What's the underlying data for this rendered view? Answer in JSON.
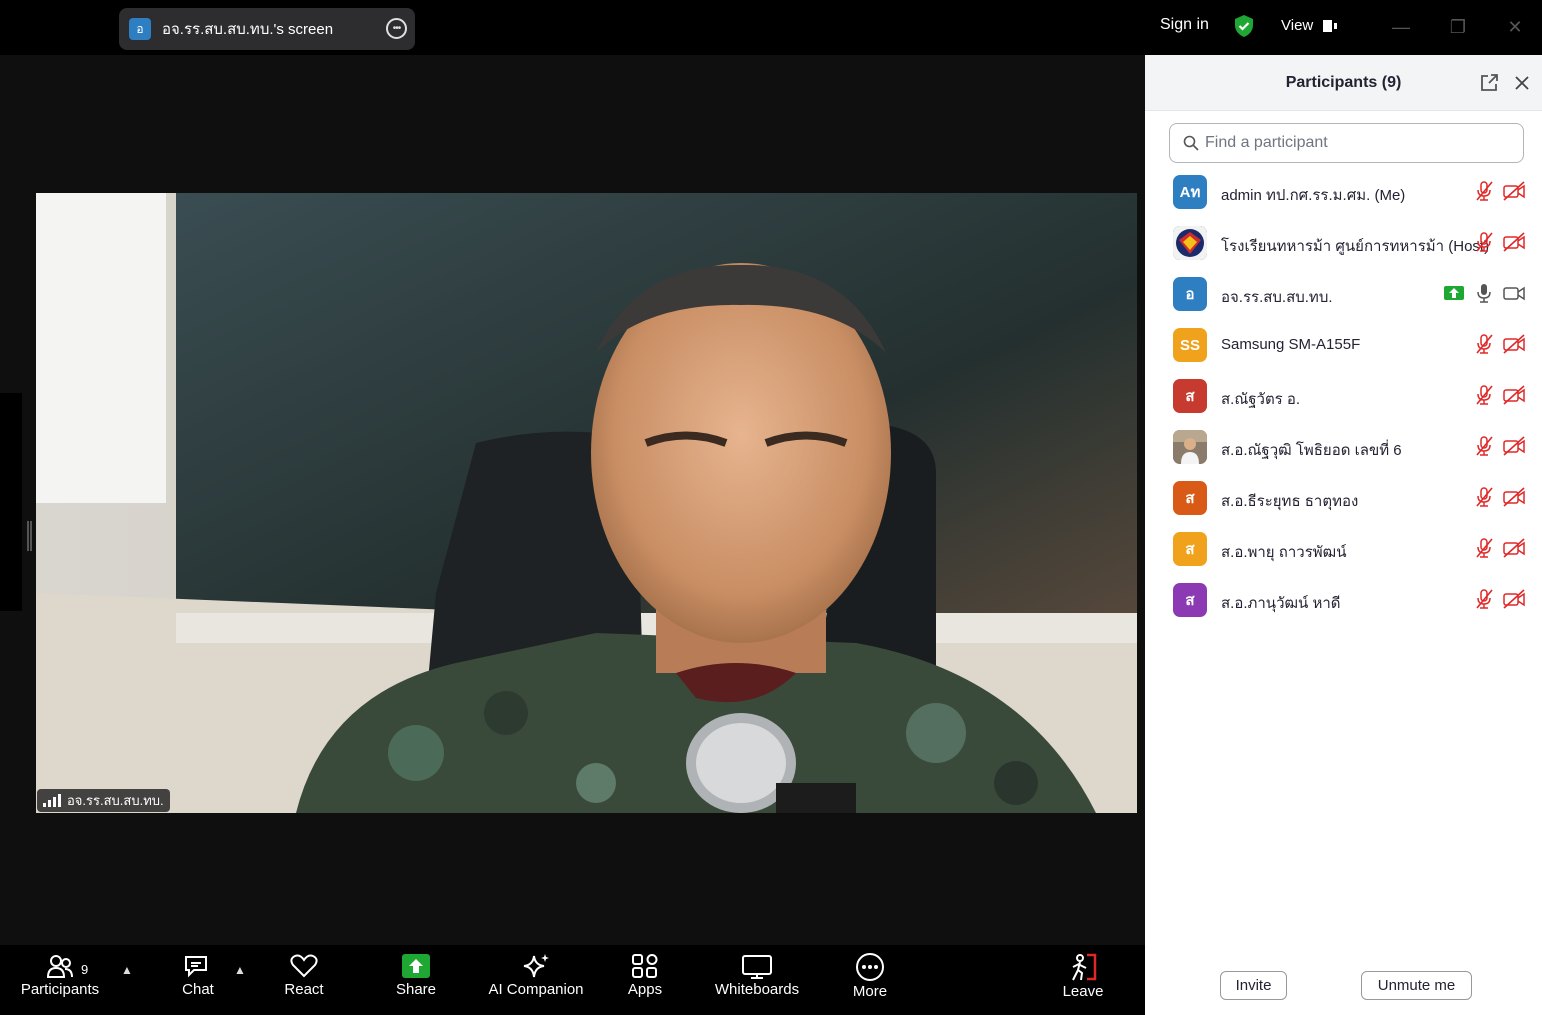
{
  "topbar": {
    "share_avatar_letter": "อ",
    "share_label": "อจ.รร.สบ.สบ.ทบ.'s screen",
    "sign_in": "Sign in",
    "view": "View",
    "colors": {
      "shield": "#1ea833",
      "background": "#000000"
    }
  },
  "video": {
    "name_tag": "อจ.รร.สบ.สบ.ทบ."
  },
  "toolbar": {
    "participants_label": "Participants",
    "participants_count": "9",
    "chat_label": "Chat",
    "react_label": "React",
    "share_label": "Share",
    "ai_label": "AI Companion",
    "apps_label": "Apps",
    "whiteboards_label": "Whiteboards",
    "more_label": "More",
    "leave_label": "Leave",
    "colors": {
      "share": "#1ea833",
      "leave": "#e02828"
    }
  },
  "panel": {
    "title": "Participants (9)",
    "search_placeholder": "Find a participant",
    "invite_label": "Invite",
    "unmute_label": "Unmute me",
    "participants": [
      {
        "initials": "Aท",
        "name": "admin ทป.กศ.รร.ม.ศม. (Me)",
        "color": "#2d7fc1",
        "muted": true,
        "video_off": true
      },
      {
        "initials": "",
        "name": "โรงเรียนทหารม้า ศูนย์การทหารม้า (Host)",
        "color": "#1b2a6b",
        "muted": true,
        "video_off": true
      },
      {
        "initials": "อ",
        "name": "อจ.รร.สบ.สบ.ทบ.",
        "color": "#2d7fc1",
        "muted": false,
        "video_off": false,
        "sharing": true
      },
      {
        "initials": "SS",
        "name": "Samsung SM-A155F",
        "color": "#f0a21c",
        "muted": true,
        "video_off": true
      },
      {
        "initials": "ส",
        "name": "ส.ณัฐวัตร อ.",
        "color": "#c63a2f",
        "muted": true,
        "video_off": true
      },
      {
        "initials": "",
        "name": "ส.อ.ณัฐวุฒิ  โพธิยอด เลขที่ 6",
        "color": "#8a7b6a",
        "muted": true,
        "video_off": true
      },
      {
        "initials": "ส",
        "name": "ส.อ.ธีระยุทธ ธาตุทอง",
        "color": "#d85a16",
        "muted": true,
        "video_off": true
      },
      {
        "initials": "ส",
        "name": "ส.อ.พายุ ถาวรพัฒน์",
        "color": "#f0a21c",
        "muted": true,
        "video_off": true
      },
      {
        "initials": "ส",
        "name": "ส.อ.ภานุวัฒน์  หาดี",
        "color": "#8b3ab3",
        "muted": true,
        "video_off": true
      }
    ]
  }
}
